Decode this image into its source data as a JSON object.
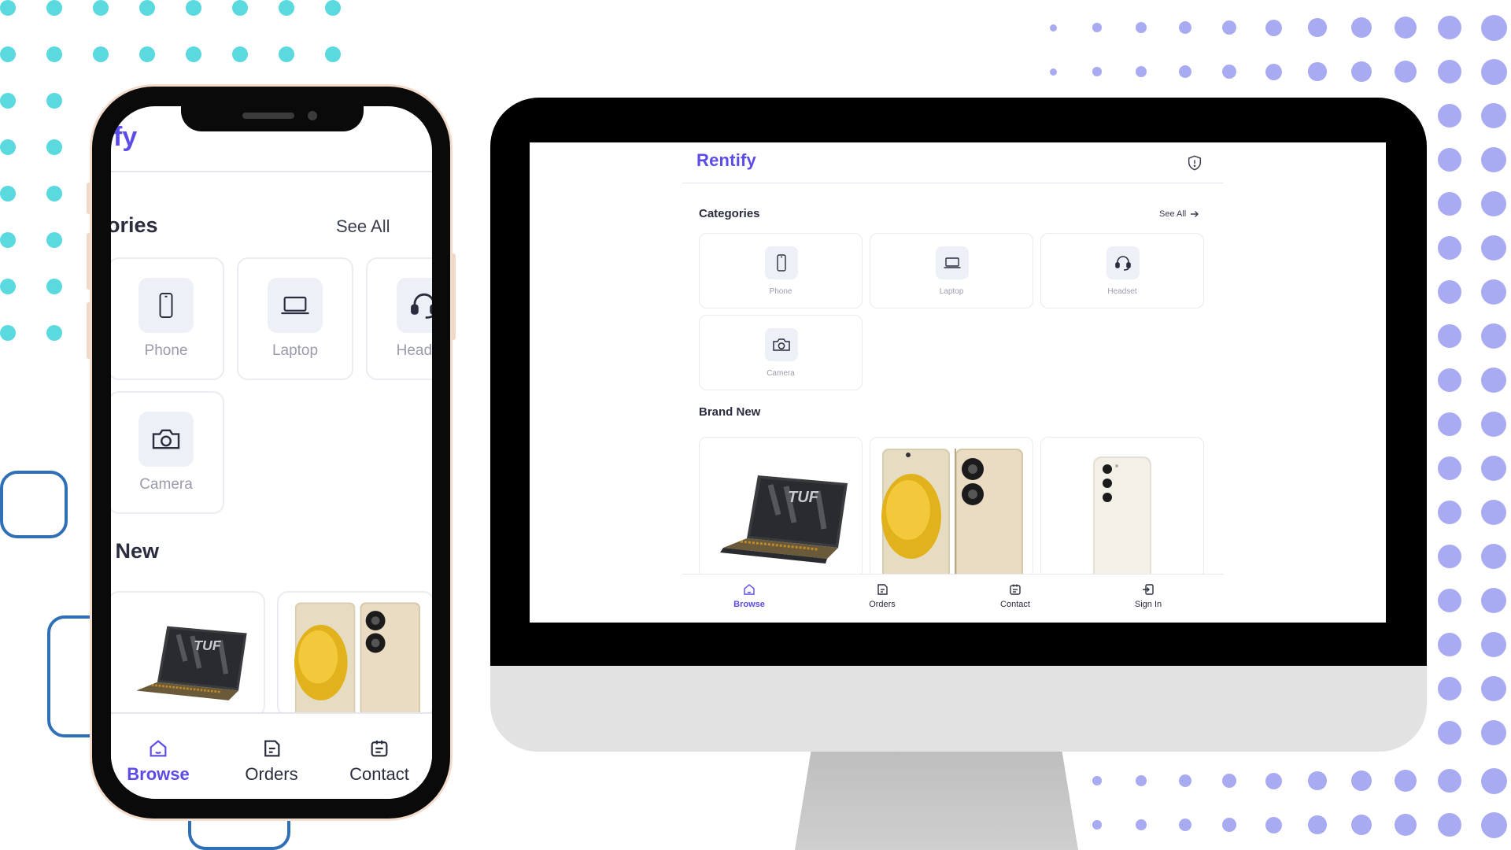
{
  "brand": {
    "name": "Rentify",
    "accent": "#5b4be8"
  },
  "header": {
    "icon": "shield-alert-icon"
  },
  "categories": {
    "title": "Categories",
    "see_all": "See All",
    "items": [
      {
        "label": "Phone",
        "icon": "phone-icon"
      },
      {
        "label": "Laptop",
        "icon": "laptop-icon"
      },
      {
        "label": "Headset",
        "icon": "headset-icon"
      },
      {
        "label": "Camera",
        "icon": "camera-icon"
      }
    ]
  },
  "brand_new": {
    "title": "Brand New",
    "products": [
      {
        "image": "laptop-product-image",
        "logo_text": "TUF"
      },
      {
        "image": "gold-phone-product-image"
      },
      {
        "image": "white-phone-product-image"
      }
    ]
  },
  "bottom_nav": {
    "items": [
      {
        "label": "Browse",
        "icon": "home-icon",
        "active": true
      },
      {
        "label": "Orders",
        "icon": "orders-icon",
        "active": false
      },
      {
        "label": "Contact",
        "icon": "contact-icon",
        "active": false
      },
      {
        "label": "Sign In",
        "icon": "sign-in-icon",
        "active": false
      }
    ]
  },
  "colors": {
    "teal_dots": "#5ad9df",
    "violet_dots": "#a9abf2",
    "outline": "#2e6fb6"
  }
}
